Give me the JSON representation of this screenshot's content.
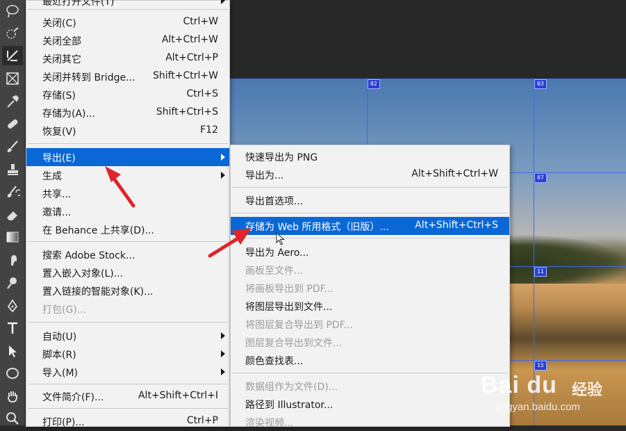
{
  "file_menu": {
    "items": [
      {
        "label": "最近打开文件(T)",
        "shortcut": "",
        "submenu": true,
        "disabled": false
      },
      {
        "label": "关闭(C)",
        "shortcut": "Ctrl+W",
        "submenu": false,
        "disabled": false
      },
      {
        "label": "关闭全部",
        "shortcut": "Alt+Ctrl+W",
        "submenu": false,
        "disabled": false
      },
      {
        "label": "关闭其它",
        "shortcut": "Alt+Ctrl+P",
        "submenu": false,
        "disabled": false
      },
      {
        "label": "关闭并转到 Bridge...",
        "shortcut": "Shift+Ctrl+W",
        "submenu": false,
        "disabled": false
      },
      {
        "label": "存储(S)",
        "shortcut": "Ctrl+S",
        "submenu": false,
        "disabled": false
      },
      {
        "label": "存储为(A)...",
        "shortcut": "Shift+Ctrl+S",
        "submenu": false,
        "disabled": false
      },
      {
        "label": "恢复(V)",
        "shortcut": "F12",
        "submenu": false,
        "disabled": false
      },
      {
        "label": "导出(E)",
        "shortcut": "",
        "submenu": true,
        "disabled": false,
        "highlighted": true
      },
      {
        "label": "生成",
        "shortcut": "",
        "submenu": true,
        "disabled": false
      },
      {
        "label": "共享...",
        "shortcut": "",
        "submenu": false,
        "disabled": false
      },
      {
        "label": "邀请...",
        "shortcut": "",
        "submenu": false,
        "disabled": false
      },
      {
        "label": "在 Behance 上共享(D)...",
        "shortcut": "",
        "submenu": false,
        "disabled": false
      },
      {
        "label": "搜索 Adobe Stock...",
        "shortcut": "",
        "submenu": false,
        "disabled": false
      },
      {
        "label": "置入嵌入对象(L)...",
        "shortcut": "",
        "submenu": false,
        "disabled": false
      },
      {
        "label": "置入链接的智能对象(K)...",
        "shortcut": "",
        "submenu": false,
        "disabled": false
      },
      {
        "label": "打包(G)...",
        "shortcut": "",
        "submenu": false,
        "disabled": true
      },
      {
        "label": "自动(U)",
        "shortcut": "",
        "submenu": true,
        "disabled": false
      },
      {
        "label": "脚本(R)",
        "shortcut": "",
        "submenu": true,
        "disabled": false
      },
      {
        "label": "导入(M)",
        "shortcut": "",
        "submenu": true,
        "disabled": false
      },
      {
        "label": "文件简介(F)...",
        "shortcut": "Alt+Shift+Ctrl+I",
        "submenu": false,
        "disabled": false
      },
      {
        "label": "打印(P)...",
        "shortcut": "Ctrl+P",
        "submenu": false,
        "disabled": false
      }
    ]
  },
  "export_menu": {
    "items": [
      {
        "label": "快速导出为 PNG",
        "shortcut": "",
        "disabled": false
      },
      {
        "label": "导出为...",
        "shortcut": "Alt+Shift+Ctrl+W",
        "disabled": false
      },
      {
        "label": "导出首选项...",
        "shortcut": "",
        "disabled": false
      },
      {
        "label": "存储为 Web 所用格式（旧版）...",
        "shortcut": "Alt+Shift+Ctrl+S",
        "disabled": false,
        "highlighted": true
      },
      {
        "label": "导出为 Aero...",
        "shortcut": "",
        "disabled": false
      },
      {
        "label": "画板至文件...",
        "shortcut": "",
        "disabled": true
      },
      {
        "label": "将画板导出到 PDF...",
        "shortcut": "",
        "disabled": true
      },
      {
        "label": "将图层导出到文件...",
        "shortcut": "",
        "disabled": false
      },
      {
        "label": "将图层复合导出到 PDF...",
        "shortcut": "",
        "disabled": true
      },
      {
        "label": "图层复合导出到文件...",
        "shortcut": "",
        "disabled": true
      },
      {
        "label": "颜色查找表...",
        "shortcut": "",
        "disabled": false
      },
      {
        "label": "数据组作为文件(D)...",
        "shortcut": "",
        "disabled": true
      },
      {
        "label": "路径到 Illustrator...",
        "shortcut": "",
        "disabled": false
      },
      {
        "label": "渲染视频...",
        "shortcut": "",
        "disabled": true
      }
    ]
  },
  "slices": {
    "badges": [
      "02",
      "03",
      "07",
      "11",
      "15"
    ]
  },
  "toolbar": {
    "tools": [
      "lasso-icon",
      "quick-selection-icon",
      "crop-icon",
      "frame-icon",
      "eyedropper-icon",
      "healing-brush-icon",
      "brush-icon",
      "clone-stamp-icon",
      "history-brush-icon",
      "eraser-icon",
      "gradient-icon",
      "smudge-icon",
      "dodge-icon",
      "pen-icon",
      "type-icon",
      "path-selection-icon",
      "ellipse-icon",
      "hand-icon",
      "zoom-icon"
    ]
  },
  "watermark": {
    "brand": "Bai du",
    "suffix": "经验",
    "url": "jingyan.baidu.com"
  },
  "colors": {
    "menu_bg": "#f2f2f2",
    "highlight": "#0a67d6",
    "disabled_text": "#9c9c9c",
    "arrow_annotation": "#e0242b",
    "slice_line": "#4169e1"
  }
}
